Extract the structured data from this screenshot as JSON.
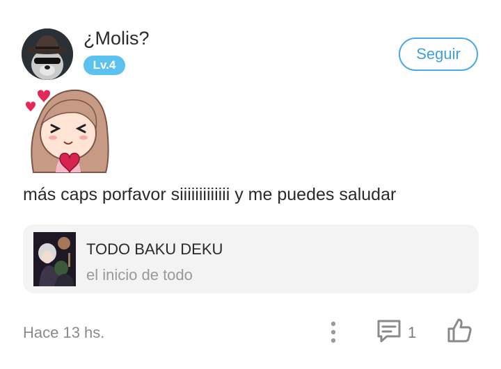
{
  "user": {
    "name": "¿Molis?",
    "level": "Lv.4",
    "avatar_icon": "bear-with-hat-avatar"
  },
  "follow_button": {
    "label": "Seguir"
  },
  "sticker": {
    "icon": "anime-girl-holding-heart-sticker"
  },
  "comment": {
    "text": "más caps porfavor siiiiiiiiiiiii y me puedes saludar"
  },
  "linked_post": {
    "title": "TODO BAKU DEKU",
    "subtitle": "el inicio de todo",
    "thumbnail_icon": "anime-artwork-thumbnail"
  },
  "footer": {
    "timestamp": "Hace 13 hs.",
    "comment_count": "1",
    "more_icon": "vertical-dots-icon",
    "comment_icon": "comment-bubble-icon",
    "like_icon": "thumbs-up-icon"
  },
  "colors": {
    "accent": "#4aa9e6",
    "badge": "#5bc2ef",
    "card_bg": "#f3f3f3",
    "muted_text": "#8a8a8a"
  }
}
